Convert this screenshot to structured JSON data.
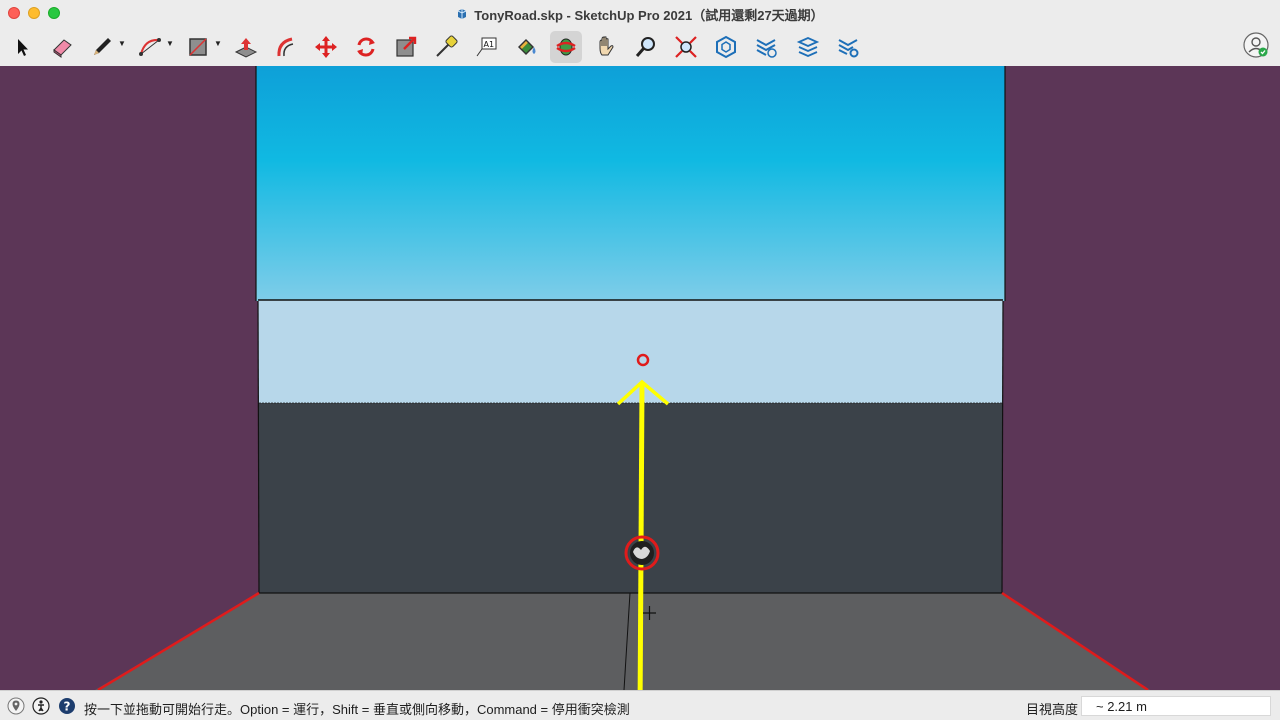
{
  "window": {
    "title": "TonyRoad.skp - SketchUp Pro 2021（試用還剩27天過期）"
  },
  "toolbar": {
    "tools": [
      {
        "name": "select-tool",
        "icon": "select-arrow-icon"
      },
      {
        "name": "eraser-tool",
        "icon": "eraser-icon"
      },
      {
        "name": "line-tool",
        "icon": "pencil-icon"
      },
      {
        "name": "arc-tool",
        "icon": "arc-icon"
      },
      {
        "name": "shape-tool",
        "icon": "rectangle-icon"
      },
      {
        "name": "push-pull-tool",
        "icon": "push-pull-icon"
      },
      {
        "name": "offset-tool",
        "icon": "offset-icon"
      },
      {
        "name": "move-tool",
        "icon": "move-icon"
      },
      {
        "name": "rotate-tool",
        "icon": "rotate-icon"
      },
      {
        "name": "scale-tool",
        "icon": "scale-icon"
      },
      {
        "name": "tape-measure-tool",
        "icon": "tape-measure-icon"
      },
      {
        "name": "text-tool",
        "icon": "text-label-icon"
      },
      {
        "name": "paint-bucket-tool",
        "icon": "paint-bucket-icon"
      },
      {
        "name": "orbit-tool",
        "icon": "orbit-icon"
      },
      {
        "name": "pan-tool",
        "icon": "hand-icon"
      },
      {
        "name": "zoom-tool",
        "icon": "magnifier-icon"
      },
      {
        "name": "zoom-extents-tool",
        "icon": "zoom-extents-icon"
      },
      {
        "name": "3d-warehouse-button",
        "icon": "warehouse-icon"
      },
      {
        "name": "extension-warehouse-button",
        "icon": "extension-warehouse-icon"
      },
      {
        "name": "layout-send-button",
        "icon": "layout-send-icon"
      },
      {
        "name": "extension-manager-button",
        "icon": "extension-manager-icon"
      }
    ],
    "active_tool": "orbit-tool",
    "text_tool_label": "A1"
  },
  "colors": {
    "background": "#5c3657",
    "sky_top": "#0ea0d8",
    "sky_bottom": "#7fcde9",
    "band": "#b7d7ea",
    "wall": "#3b4249",
    "ground": "#5d5e60",
    "axis_red": "#e01b1b",
    "axis_yellow": "#ffff00"
  },
  "statusbar": {
    "instruction": "按一下並拖動可開始行走。Option = 運行，Shift = 垂直或側向移動，Command = 停用衝突檢測",
    "measurement_label": "目視高度",
    "measurement_value": "~ 2.21 m"
  }
}
